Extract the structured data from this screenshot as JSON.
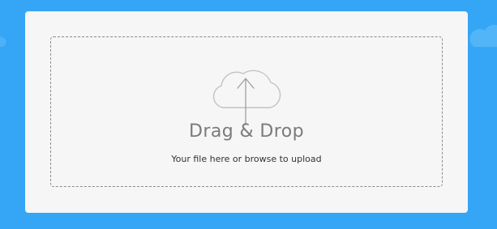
{
  "colors": {
    "background": "#35a6f5",
    "card": "#f6f6f6",
    "dashed_border": "#8a8a8a",
    "title_text": "#7b7b7b",
    "subtitle_text": "#333333",
    "icon_stroke": "#c2c2c2"
  },
  "icons": {
    "upload": "cloud-upload-icon",
    "background_decor": "cloud-icon"
  },
  "dropzone": {
    "title": "Drag & Drop",
    "subtitle": "Your file here or browse to upload"
  }
}
